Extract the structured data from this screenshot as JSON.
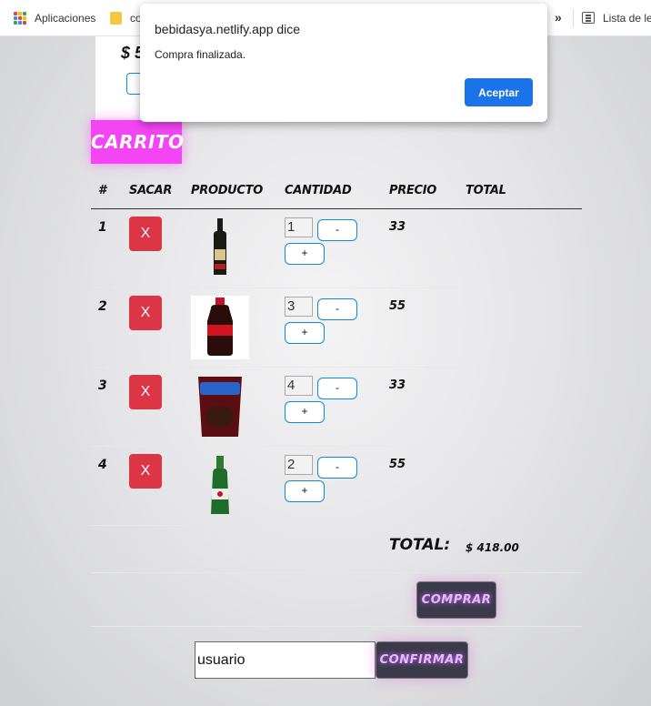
{
  "bookmarks": {
    "apps_label": "Aplicaciones",
    "folder_label": "co",
    "more": "»",
    "reading_list": "Lista de le"
  },
  "background_card": {
    "price": "$ 5"
  },
  "dialog": {
    "title": "bebidasya.netlify.app dice",
    "message": "Compra finalizada.",
    "accept_label": "Aceptar"
  },
  "cart": {
    "title": "CARRITO",
    "headers": [
      "#",
      "SACAR",
      "PRODUCTO",
      "CANTIDAD",
      "PRECIO",
      "TOTAL"
    ],
    "remove_label": "X",
    "minus_label": "-",
    "plus_label": "+",
    "rows": [
      {
        "num": "1",
        "qty": "1",
        "price": "33",
        "product": "liquor-bottle"
      },
      {
        "num": "2",
        "qty": "3",
        "price": "55",
        "product": "coca-cola-bottle"
      },
      {
        "num": "3",
        "qty": "4",
        "price": "33",
        "product": "krachitos-chips-bag"
      },
      {
        "num": "4",
        "qty": "2",
        "price": "55",
        "product": "heineken-bottle"
      }
    ],
    "total_label": "TOTAL:",
    "total_value": "$ 418.00",
    "buy_label": "COMPRAR"
  },
  "checkout": {
    "user_value": "usuario",
    "confirm_label": "CONFIRMAR"
  },
  "colors": {
    "accent_blue": "#1a73e8",
    "remove_red": "#dc3545",
    "carrito_pink": "#f445f4",
    "qty_border": "#0d8bd6"
  }
}
